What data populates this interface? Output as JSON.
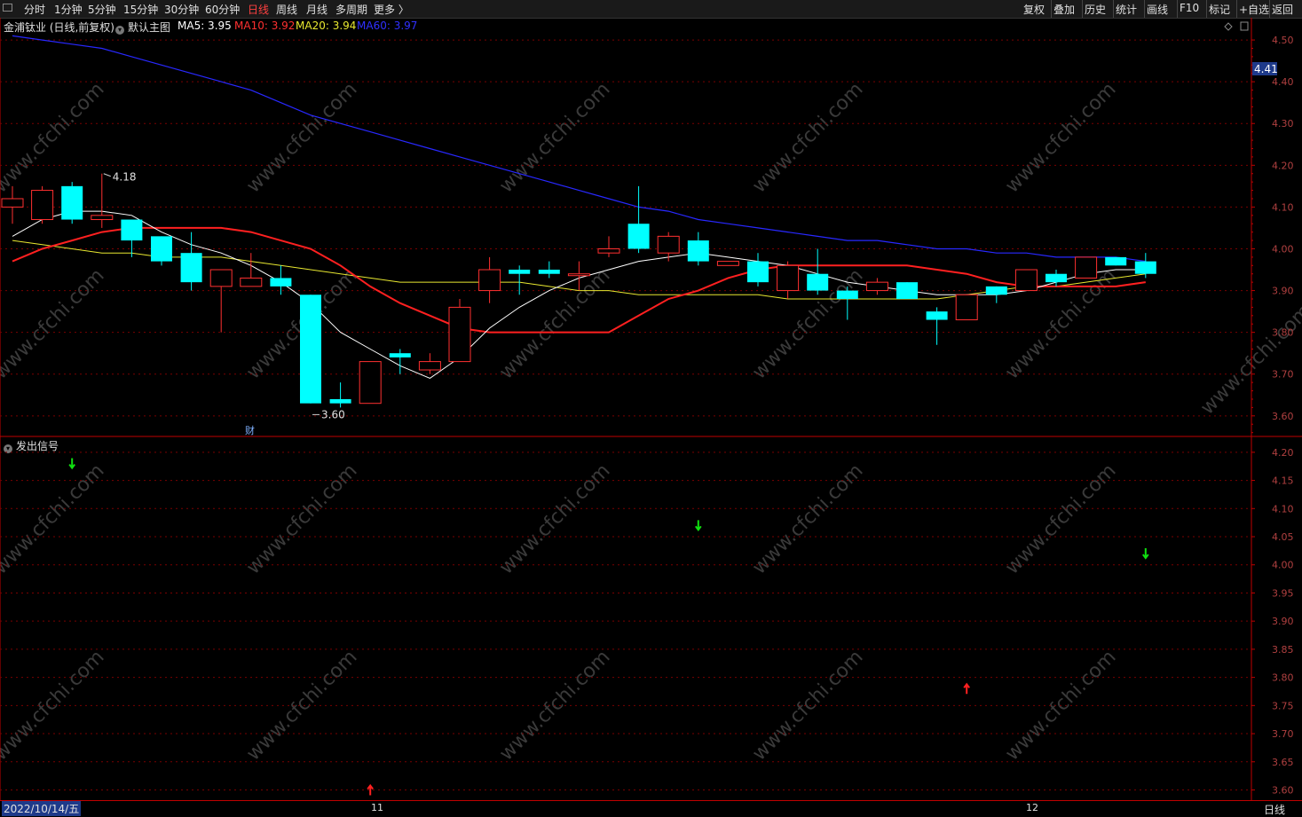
{
  "toolbar": {
    "left_items": [
      "分时",
      "1分钟",
      "5分钟",
      "15分钟",
      "30分钟",
      "60分钟",
      "日线",
      "周线",
      "月线",
      "多周期",
      "更多 〉"
    ],
    "active_item": "日线",
    "right_items": [
      "复权",
      "叠加",
      "历史",
      "统计",
      "画线",
      "F10",
      "标记",
      "+自选",
      "返回"
    ]
  },
  "main_chart": {
    "stock_label": "金浦钛业 (日线,前复权)",
    "template_label": "默认主图",
    "ma5_label": "MA5: 3.95",
    "ma10_label": "MA10: 3.92",
    "ma20_label": "MA20: 3.94",
    "ma60_label": "MA60: 3.97",
    "price_axis_ticks": [
      "4.50",
      "4.40",
      "4.30",
      "4.20",
      "4.10",
      "4.00",
      "3.90",
      "3.80",
      "3.70",
      "3.60"
    ],
    "current_price_tag": "4.41",
    "high_marker": "4.18",
    "low_marker": "3.60",
    "finance_marker": "财",
    "watermark": "www.cfchi.com"
  },
  "sub_chart": {
    "title": "发出信号",
    "axis_ticks": [
      "4.20",
      "4.15",
      "4.10",
      "4.05",
      "4.00",
      "3.95",
      "3.90",
      "3.85",
      "3.80",
      "3.75",
      "3.70",
      "3.65",
      "3.60"
    ]
  },
  "date_bar": {
    "start_date": "2022/10/14/五",
    "month_11": "11",
    "month_12": "12",
    "period": "日线"
  },
  "colors": {
    "up": "#ff3030",
    "down": "#00ffff",
    "ma5": "#ffffff",
    "ma10": "#ff2020",
    "ma20": "#e8e830",
    "ma60": "#2828ff",
    "grid": "#7a0000",
    "buy_signal": "#ff2020",
    "sell_signal": "#10e010"
  },
  "chart_data": {
    "type": "candlestick",
    "ylim": [
      3.55,
      4.52
    ],
    "candles": [
      {
        "o": 4.1,
        "h": 4.15,
        "l": 4.06,
        "c": 4.12
      },
      {
        "o": 4.07,
        "h": 4.15,
        "l": 4.06,
        "c": 4.14
      },
      {
        "o": 4.15,
        "h": 4.16,
        "l": 4.06,
        "c": 4.07
      },
      {
        "o": 4.07,
        "h": 4.18,
        "l": 4.05,
        "c": 4.08
      },
      {
        "o": 4.07,
        "h": 4.07,
        "l": 3.98,
        "c": 4.02
      },
      {
        "o": 4.03,
        "h": 4.03,
        "l": 3.96,
        "c": 3.97
      },
      {
        "o": 3.99,
        "h": 4.04,
        "l": 3.9,
        "c": 3.92
      },
      {
        "o": 3.91,
        "h": 3.95,
        "l": 3.8,
        "c": 3.95
      },
      {
        "o": 3.91,
        "h": 3.99,
        "l": 3.91,
        "c": 3.93
      },
      {
        "o": 3.93,
        "h": 3.96,
        "l": 3.89,
        "c": 3.91
      },
      {
        "o": 3.89,
        "h": 3.89,
        "l": 3.63,
        "c": 3.63
      },
      {
        "o": 3.64,
        "h": 3.68,
        "l": 3.62,
        "c": 3.63
      },
      {
        "o": 3.63,
        "h": 3.73,
        "l": 3.63,
        "c": 3.73
      },
      {
        "o": 3.75,
        "h": 3.76,
        "l": 3.7,
        "c": 3.74
      },
      {
        "o": 3.71,
        "h": 3.75,
        "l": 3.7,
        "c": 3.73
      },
      {
        "o": 3.73,
        "h": 3.88,
        "l": 3.73,
        "c": 3.86
      },
      {
        "o": 3.9,
        "h": 3.98,
        "l": 3.87,
        "c": 3.95
      },
      {
        "o": 3.95,
        "h": 3.96,
        "l": 3.89,
        "c": 3.94
      },
      {
        "o": 3.95,
        "h": 3.97,
        "l": 3.93,
        "c": 3.94
      },
      {
        "o": 3.94,
        "h": 3.97,
        "l": 3.9,
        "c": 3.94
      },
      {
        "o": 3.99,
        "h": 4.03,
        "l": 3.98,
        "c": 4.0
      },
      {
        "o": 4.06,
        "h": 4.15,
        "l": 3.99,
        "c": 4.0
      },
      {
        "o": 3.99,
        "h": 4.04,
        "l": 3.97,
        "c": 4.03
      },
      {
        "o": 4.02,
        "h": 4.04,
        "l": 3.96,
        "c": 3.97
      },
      {
        "o": 3.96,
        "h": 3.97,
        "l": 3.96,
        "c": 3.97
      },
      {
        "o": 3.97,
        "h": 3.99,
        "l": 3.91,
        "c": 3.92
      },
      {
        "o": 3.9,
        "h": 3.97,
        "l": 3.88,
        "c": 3.96
      },
      {
        "o": 3.94,
        "h": 4.0,
        "l": 3.89,
        "c": 3.9
      },
      {
        "o": 3.9,
        "h": 3.91,
        "l": 3.83,
        "c": 3.88
      },
      {
        "o": 3.9,
        "h": 3.93,
        "l": 3.89,
        "c": 3.92
      },
      {
        "o": 3.92,
        "h": 3.92,
        "l": 3.88,
        "c": 3.88
      },
      {
        "o": 3.85,
        "h": 3.86,
        "l": 3.77,
        "c": 3.83
      },
      {
        "o": 3.83,
        "h": 3.89,
        "l": 3.83,
        "c": 3.89
      },
      {
        "o": 3.91,
        "h": 3.91,
        "l": 3.87,
        "c": 3.89
      },
      {
        "o": 3.9,
        "h": 3.95,
        "l": 3.9,
        "c": 3.95
      },
      {
        "o": 3.94,
        "h": 3.95,
        "l": 3.91,
        "c": 3.92
      },
      {
        "o": 3.93,
        "h": 3.98,
        "l": 3.93,
        "c": 3.98
      },
      {
        "o": 3.98,
        "h": 3.98,
        "l": 3.96,
        "c": 3.96
      },
      {
        "o": 3.97,
        "h": 3.99,
        "l": 3.93,
        "c": 3.94
      }
    ],
    "ma5": [
      4.03,
      4.07,
      4.09,
      4.09,
      4.08,
      4.04,
      4.01,
      3.99,
      3.96,
      3.92,
      3.87,
      3.8,
      3.76,
      3.72,
      3.69,
      3.74,
      3.81,
      3.86,
      3.9,
      3.93,
      3.95,
      3.97,
      3.98,
      3.99,
      3.98,
      3.97,
      3.96,
      3.94,
      3.92,
      3.91,
      3.9,
      3.89,
      3.89,
      3.89,
      3.9,
      3.92,
      3.94,
      3.95,
      3.95
    ],
    "ma10": [
      3.97,
      4.0,
      4.02,
      4.04,
      4.05,
      4.05,
      4.05,
      4.05,
      4.04,
      4.02,
      4.0,
      3.96,
      3.91,
      3.87,
      3.84,
      3.81,
      3.8,
      3.8,
      3.8,
      3.8,
      3.8,
      3.84,
      3.88,
      3.9,
      3.93,
      3.95,
      3.96,
      3.96,
      3.96,
      3.96,
      3.96,
      3.95,
      3.94,
      3.92,
      3.91,
      3.91,
      3.91,
      3.91,
      3.92
    ],
    "ma20": [
      4.02,
      4.01,
      4.0,
      3.99,
      3.99,
      3.98,
      3.98,
      3.98,
      3.97,
      3.96,
      3.95,
      3.94,
      3.93,
      3.92,
      3.92,
      3.92,
      3.92,
      3.92,
      3.91,
      3.9,
      3.9,
      3.89,
      3.89,
      3.89,
      3.89,
      3.89,
      3.88,
      3.88,
      3.88,
      3.88,
      3.88,
      3.88,
      3.89,
      3.9,
      3.91,
      3.91,
      3.92,
      3.93,
      3.94
    ],
    "ma60": [
      4.51,
      4.5,
      4.49,
      4.48,
      4.46,
      4.44,
      4.42,
      4.4,
      4.38,
      4.35,
      4.32,
      4.3,
      4.28,
      4.26,
      4.24,
      4.22,
      4.2,
      4.18,
      4.16,
      4.14,
      4.12,
      4.1,
      4.09,
      4.07,
      4.06,
      4.05,
      4.04,
      4.03,
      4.02,
      4.02,
      4.01,
      4.0,
      4.0,
      3.99,
      3.99,
      3.98,
      3.98,
      3.98,
      3.97
    ],
    "signals": [
      {
        "index": 2,
        "type": "sell",
        "value": 4.18
      },
      {
        "index": 12,
        "type": "buy",
        "value": 3.6
      },
      {
        "index": 23,
        "type": "sell",
        "value": 4.07
      },
      {
        "index": 32,
        "type": "buy",
        "value": 3.78
      },
      {
        "index": 38,
        "type": "sell",
        "value": 4.02
      }
    ]
  }
}
